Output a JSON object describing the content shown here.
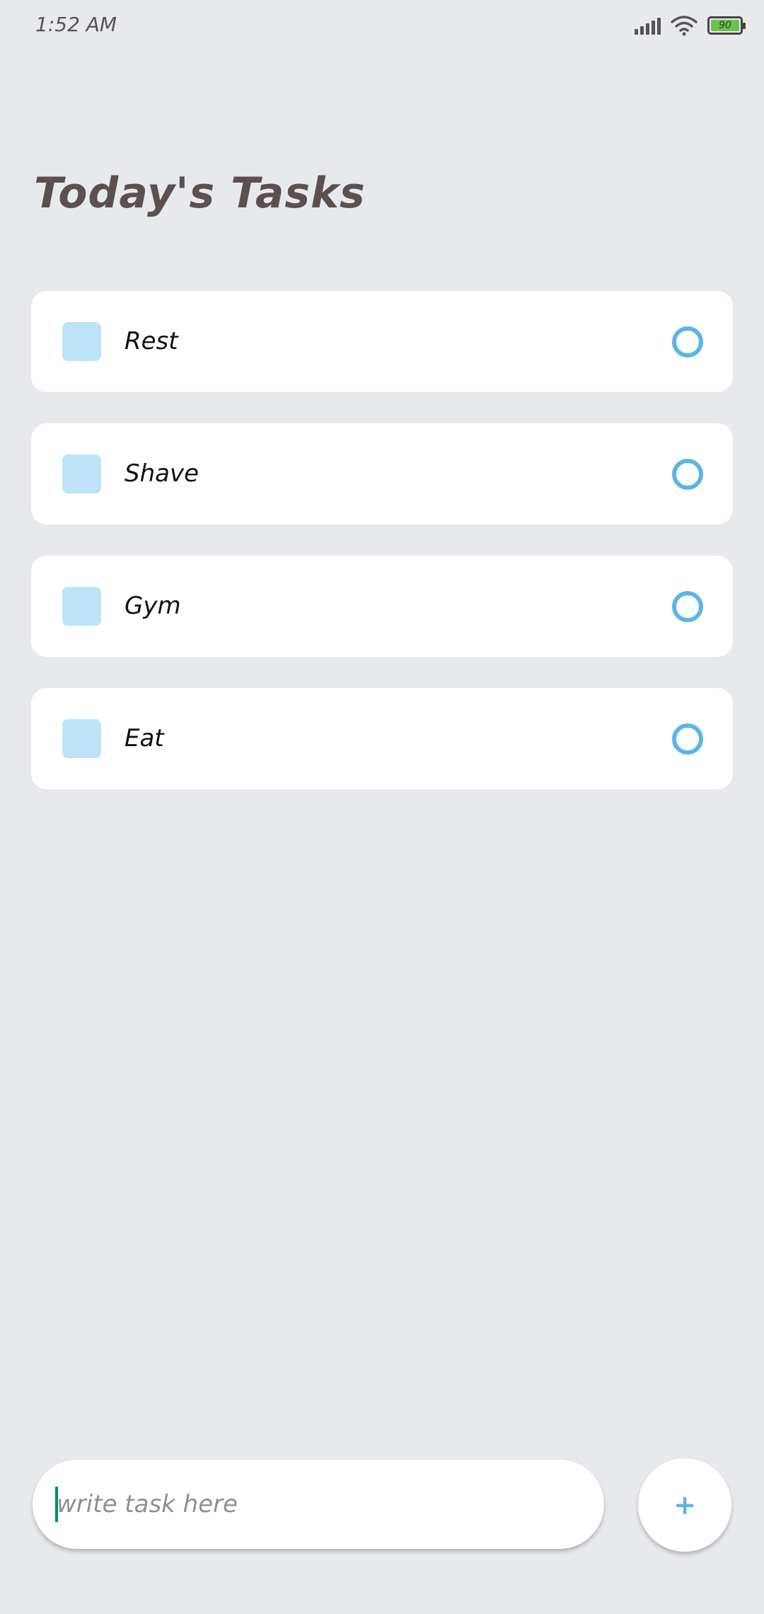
{
  "status_bar": {
    "time": "1:52 AM",
    "battery_level": "90",
    "icons": [
      "signal-icon",
      "wifi-icon",
      "battery-icon"
    ]
  },
  "title": "Today's Tasks",
  "tasks": [
    {
      "label": "Rest"
    },
    {
      "label": "Shave"
    },
    {
      "label": "Gym"
    },
    {
      "label": "Eat"
    }
  ],
  "input": {
    "placeholder": "write task here",
    "value": ""
  },
  "add_button": {
    "label": "+",
    "icon": "plus-icon"
  },
  "colors": {
    "background": "#e8e9ed",
    "card": "#ffffff",
    "square": "#bde4f8",
    "accent": "#5ab4e8",
    "title": "#5b5050"
  }
}
